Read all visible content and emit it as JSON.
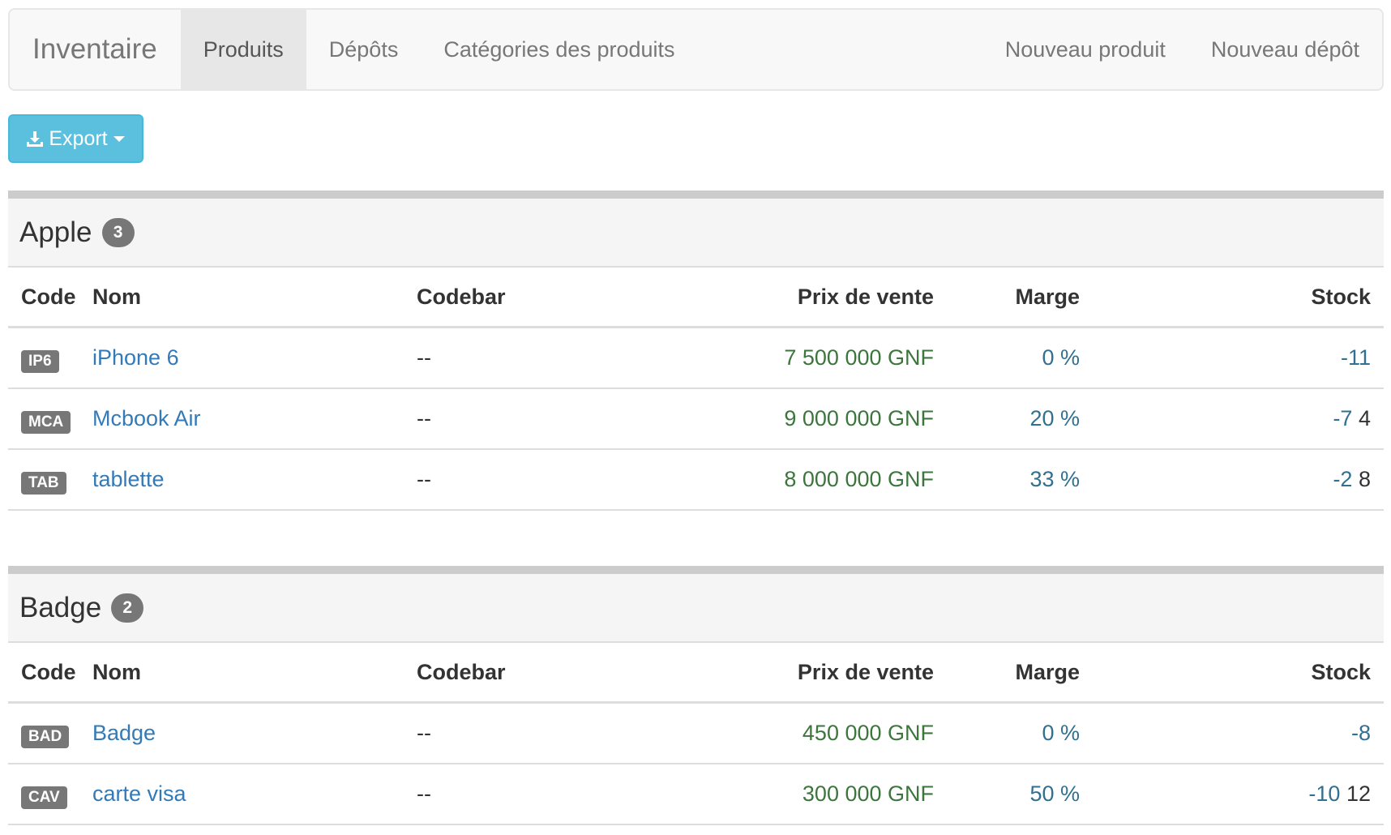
{
  "navbar": {
    "brand": "Inventaire",
    "left": [
      {
        "label": "Produits",
        "active": true
      },
      {
        "label": "Dépôts",
        "active": false
      },
      {
        "label": "Catégories des produits",
        "active": false
      }
    ],
    "right": [
      {
        "label": "Nouveau produit"
      },
      {
        "label": "Nouveau dépôt"
      }
    ]
  },
  "export_button": {
    "label": "Export",
    "icon": "download-icon",
    "caret": "caret-down-icon"
  },
  "table_headers": {
    "code": "Code",
    "name": "Nom",
    "codebar": "Codebar",
    "price": "Prix de vente",
    "margin": "Marge",
    "stock": "Stock"
  },
  "categories": [
    {
      "title": "Apple",
      "count": "3",
      "products": [
        {
          "code": "IP6",
          "name": "iPhone 6",
          "codebar": "--",
          "price": "7 500 000 GNF",
          "margin": "0 %",
          "stock_neg": "-11",
          "stock_pos": ""
        },
        {
          "code": "MCA",
          "name": "Mcbook Air",
          "codebar": "--",
          "price": "9 000 000 GNF",
          "margin": "20 %",
          "stock_neg": "-7",
          "stock_pos": "4"
        },
        {
          "code": "TAB",
          "name": "tablette",
          "codebar": "--",
          "price": "8 000 000 GNF",
          "margin": "33 %",
          "stock_neg": "-2",
          "stock_pos": "8"
        }
      ]
    },
    {
      "title": "Badge",
      "count": "2",
      "products": [
        {
          "code": "BAD",
          "name": "Badge",
          "codebar": "--",
          "price": "450 000 GNF",
          "margin": "0 %",
          "stock_neg": "-8",
          "stock_pos": ""
        },
        {
          "code": "CAV",
          "name": "carte visa",
          "codebar": "--",
          "price": "300 000 GNF",
          "margin": "50 %",
          "stock_neg": "-10",
          "stock_pos": "12"
        }
      ]
    }
  ],
  "colors": {
    "link": "#337ab7",
    "price": "#3c763d",
    "margin": "#31708f",
    "export_bg": "#5bc0de",
    "label_bg": "#777777"
  }
}
